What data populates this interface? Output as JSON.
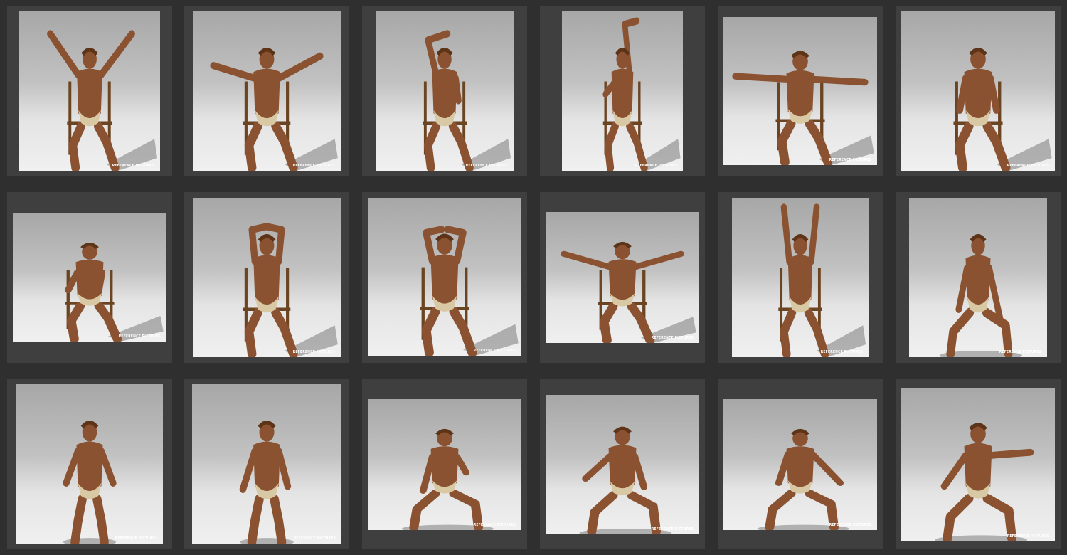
{
  "gallery": {
    "watermark": "REFERENCE PICTURES",
    "thumbnails": [
      {
        "pose": "seated-arms-raised-wide"
      },
      {
        "pose": "seated-arms-spread"
      },
      {
        "pose": "seated-arm-over-head"
      },
      {
        "pose": "seated-arm-reaching-up"
      },
      {
        "pose": "seated-arms-out-wide"
      },
      {
        "pose": "seated-leaning-forward"
      },
      {
        "pose": "seated-crouched-side"
      },
      {
        "pose": "seated-hands-behind-head"
      },
      {
        "pose": "seated-back-hands-on-head"
      },
      {
        "pose": "seated-arms-outstretched"
      },
      {
        "pose": "seated-arms-pointing-up"
      },
      {
        "pose": "kneeling-hand-on-knee"
      },
      {
        "pose": "standing-front"
      },
      {
        "pose": "standing-walking"
      },
      {
        "pose": "kneeling-looking-down"
      },
      {
        "pose": "kneeling-arm-forward"
      },
      {
        "pose": "kneeling-arm-back"
      },
      {
        "pose": "kneeling-reaching-out"
      }
    ]
  }
}
